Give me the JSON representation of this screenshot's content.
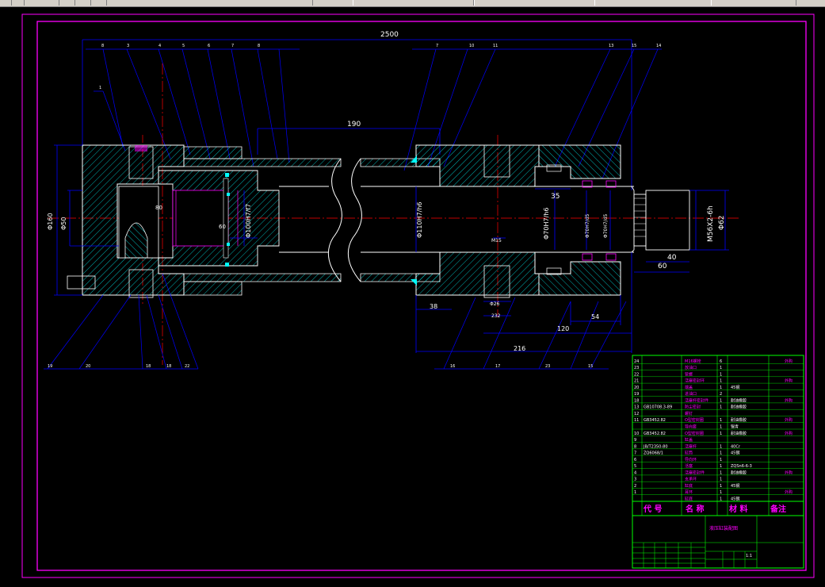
{
  "toolbar": {
    "tabs": [
      "",
      "",
      "",
      "",
      ""
    ]
  },
  "colors": {
    "border": "#ff00ff",
    "hatch": "#00ffff",
    "outline": "#ffffff",
    "dim": "#0000ff",
    "center": "#ff0000",
    "table_line": "#00ff00",
    "table_text": "#ff00ff"
  },
  "dimensions": {
    "overall": "2500",
    "rod_len": "190",
    "d160": "Φ160",
    "d50": "Φ50",
    "d100": "Φ100H7/f7",
    "d80": "80",
    "d60": "60",
    "d110": "Φ110H7/h6",
    "d70": "Φ70H7/h6",
    "d35": "35",
    "d70b": "Φ70H7/d5",
    "d70c": "Φ70H7/d5",
    "thread": "M56X2-6h",
    "d62": "Φ62",
    "d40": "40",
    "d60b": "60",
    "d38": "38",
    "d216": "216",
    "d120": "120",
    "d54": "54",
    "m15": "M15",
    "d26": "Φ26",
    "d32": "232"
  },
  "parts_table": {
    "rows": [
      {
        "no": "24",
        "code": "",
        "name": "M16螺栓",
        "qty": "6",
        "mat": "",
        "note": "外购"
      },
      {
        "no": "23",
        "code": "",
        "name": "放油口",
        "qty": "1",
        "mat": "",
        "note": ""
      },
      {
        "no": "22",
        "code": "",
        "name": "管螺",
        "qty": "1",
        "mat": "",
        "note": ""
      },
      {
        "no": "21",
        "code": "",
        "name": "活塞密封环",
        "qty": "1",
        "mat": "",
        "note": "外购"
      },
      {
        "no": "20",
        "code": "",
        "name": "端盖",
        "qty": "1",
        "mat": "45钢",
        "note": ""
      },
      {
        "no": "19",
        "code": "",
        "name": "进油口",
        "qty": "2",
        "mat": "",
        "note": ""
      },
      {
        "no": "18",
        "code": "",
        "name": "活塞杆密封件",
        "qty": "1",
        "mat": "耐油橡胶",
        "note": "外购"
      },
      {
        "no": "13",
        "code": "GB10708.3-89",
        "name": "防尘密封",
        "qty": "1",
        "mat": "耐油橡胶",
        "note": ""
      },
      {
        "no": "12",
        "code": "",
        "name": "螺钉",
        "qty": "",
        "mat": "",
        "note": ""
      },
      {
        "no": "11",
        "code": "GB3452.82",
        "name": "O型密封圈",
        "qty": "1",
        "mat": "耐油橡胶",
        "note": "外购"
      },
      {
        "no": "",
        "code": "",
        "name": "导向套",
        "qty": "1",
        "mat": "锡青",
        "note": ""
      },
      {
        "no": "10",
        "code": "GB3452.82",
        "name": "O型密封圈",
        "qty": "1",
        "mat": "耐油橡胶",
        "note": "外购"
      },
      {
        "no": "9",
        "code": "",
        "name": "缸盖",
        "qty": "",
        "mat": "",
        "note": ""
      },
      {
        "no": "8",
        "code": "JB/T2350-80",
        "name": "活塞杆",
        "qty": "1",
        "mat": "40Cr",
        "note": ""
      },
      {
        "no": "7",
        "code": "ZQ6068/1",
        "name": "缸筒",
        "qty": "1",
        "mat": "45钢",
        "note": ""
      },
      {
        "no": "6",
        "code": "",
        "name": "导向环",
        "qty": "1",
        "mat": "",
        "note": ""
      },
      {
        "no": "5",
        "code": "",
        "name": "活塞",
        "qty": "1",
        "mat": "ZQSn6-6-3",
        "note": ""
      },
      {
        "no": "4",
        "code": "",
        "name": "活塞密封件",
        "qty": "1",
        "mat": "耐油橡胶",
        "note": "外购"
      },
      {
        "no": "3",
        "code": "",
        "name": "支承环",
        "qty": "1",
        "mat": "",
        "note": ""
      },
      {
        "no": "2",
        "code": "",
        "name": "缸底",
        "qty": "1",
        "mat": "45钢",
        "note": ""
      },
      {
        "no": "1",
        "code": "",
        "name": "耳环",
        "qty": "1",
        "mat": "",
        "note": "外购"
      },
      {
        "no": "",
        "code": "",
        "name": "缸底",
        "qty": "1",
        "mat": "45钢",
        "note": ""
      }
    ],
    "header": {
      "code": "代 号",
      "name": "名 称",
      "mat": "材 料",
      "note": "备注"
    },
    "title_block": {
      "title": "液压缸装配图",
      "scale": "1:1"
    }
  }
}
